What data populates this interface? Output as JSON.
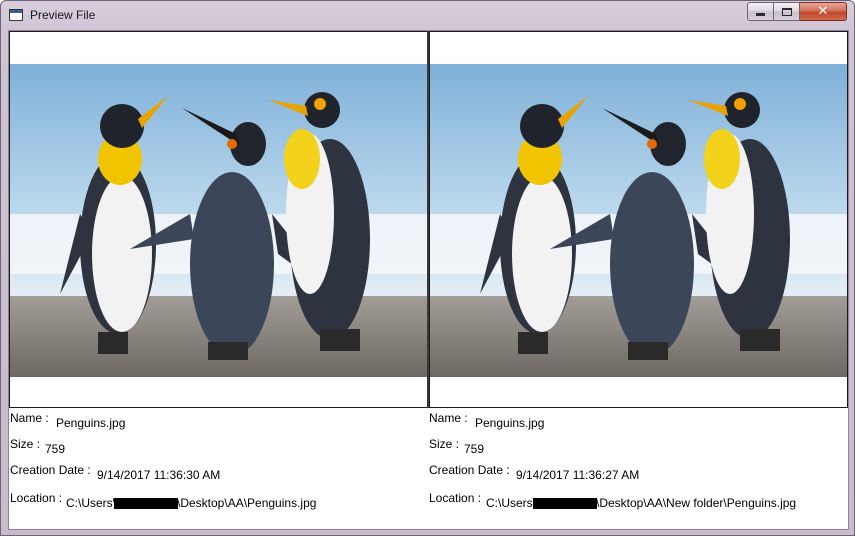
{
  "window": {
    "title": "Preview File",
    "controls": {
      "minimize": "minimize",
      "maximize": "maximize",
      "close": "✕"
    }
  },
  "panes": [
    {
      "image_alt": "penguins-photo",
      "name_label": "Name :",
      "name_value": "Penguins.jpg",
      "size_label": "Size :",
      "size_value": "759",
      "creation_label": "Creation Date :",
      "creation_value": "9/14/2017 11:36:30 AM",
      "location_label": "Location :",
      "location_prefix": "C:\\Users\\",
      "location_suffix": "\\Desktop\\AA\\Penguins.jpg"
    },
    {
      "image_alt": "penguins-photo",
      "name_label": "Name :",
      "name_value": "Penguins.jpg",
      "size_label": "Size :",
      "size_value": "759",
      "creation_label": "Creation Date :",
      "creation_value": "9/14/2017 11:36:27 AM",
      "location_label": "Location :",
      "location_prefix": "C:\\Users\\",
      "location_suffix": "\\Desktop\\AA\\New folder\\Penguins.jpg"
    }
  ],
  "colors": {
    "sky": "#9cc3e0",
    "sand": "#8f8a84",
    "penguin_dark": "#2d3440",
    "penguin_light": "#f2f2f2",
    "penguin_yellow": "#f2c400"
  }
}
